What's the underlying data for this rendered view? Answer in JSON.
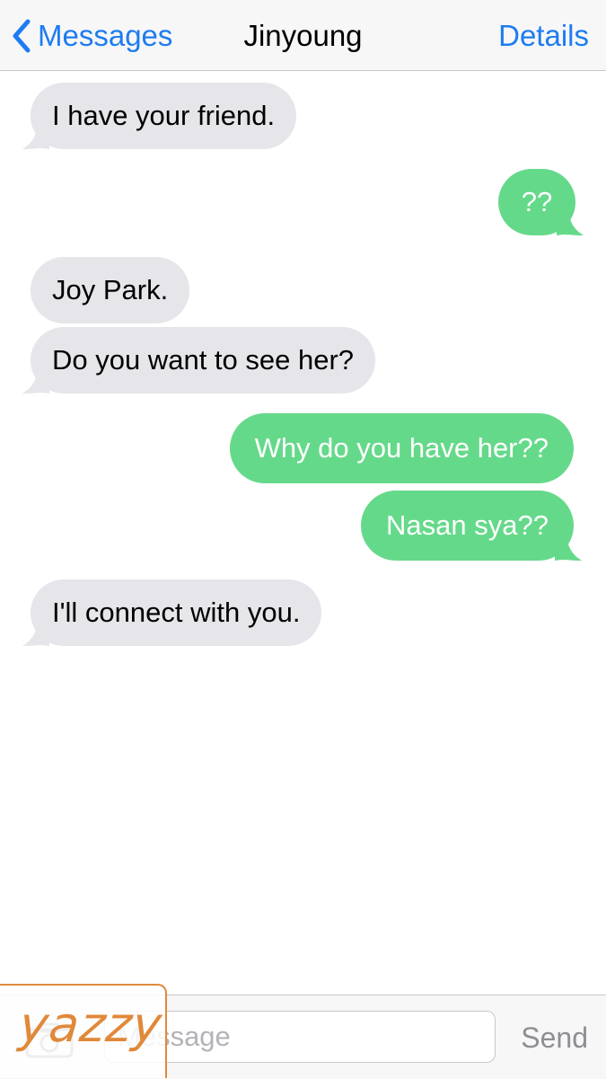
{
  "header": {
    "back_label": "Messages",
    "title": "Jinyoung",
    "details_label": "Details"
  },
  "messages": [
    {
      "direction": "incoming",
      "text": "I have your friend."
    },
    {
      "direction": "outgoing",
      "text": "??"
    },
    {
      "direction": "incoming",
      "text": "Joy Park."
    },
    {
      "direction": "incoming",
      "text": "Do you want to see her?"
    },
    {
      "direction": "outgoing",
      "text": "Why do you have her??"
    },
    {
      "direction": "outgoing",
      "text": "Nasan sya??"
    },
    {
      "direction": "incoming",
      "text": "I'll connect with you."
    }
  ],
  "input": {
    "placeholder": "Message",
    "send_label": "Send"
  },
  "watermark": "yazzy",
  "colors": {
    "accent": "#1e7cf0",
    "incoming_bubble": "#e5e5ea",
    "outgoing_bubble": "#65d98a",
    "watermark": "#e0893a"
  },
  "icons": {
    "back": "chevron-left-icon",
    "camera": "camera-icon"
  }
}
